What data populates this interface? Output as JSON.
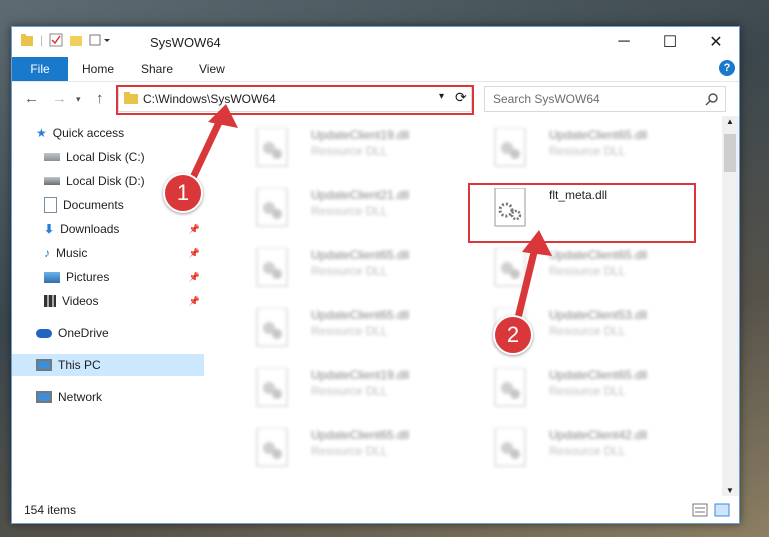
{
  "window": {
    "title": "SysWOW64",
    "minimize": "─",
    "maximize": "☐",
    "close": "✕"
  },
  "ribbon": {
    "tabs": [
      "File",
      "Home",
      "Share",
      "View"
    ],
    "help": "?"
  },
  "nav": {
    "address": "C:\\Windows\\SysWOW64",
    "search_placeholder": "Search SysWOW64"
  },
  "sidebar": {
    "items": [
      {
        "label": "Quick access",
        "icon": "star-icon"
      },
      {
        "label": "Local Disk (C:)",
        "icon": "drive-icon"
      },
      {
        "label": "Local Disk (D:)",
        "icon": "drive-icon"
      },
      {
        "label": "Documents",
        "icon": "documents-icon"
      },
      {
        "label": "Downloads",
        "icon": "download-icon"
      },
      {
        "label": "Music",
        "icon": "music-icon"
      },
      {
        "label": "Pictures",
        "icon": "pictures-icon"
      },
      {
        "label": "Videos",
        "icon": "videos-icon"
      },
      {
        "label": "OneDrive",
        "icon": "cloud-icon"
      },
      {
        "label": "This PC",
        "icon": "computer-icon",
        "selected": true
      },
      {
        "label": "Network",
        "icon": "network-icon"
      }
    ]
  },
  "files": [
    {
      "name": "UpdateClient19.dll",
      "type": "Resource DLL",
      "blurred": true
    },
    {
      "name": "UpdateClient65.dll",
      "type": "Resource DLL",
      "blurred": true
    },
    {
      "name": "UpdateClient21.dll",
      "type": "Resource DLL",
      "blurred": true
    },
    {
      "name": "flt_meta.dll",
      "type": "",
      "blurred": false
    },
    {
      "name": "UpdateClient65.dll",
      "type": "Resource DLL",
      "blurred": true
    },
    {
      "name": "UpdateClient65.dll",
      "type": "Resource DLL",
      "blurred": true
    },
    {
      "name": "UpdateClient65.dll",
      "type": "Resource DLL",
      "blurred": true
    },
    {
      "name": "UpdateClient53.dll",
      "type": "Resource DLL",
      "blurred": true
    },
    {
      "name": "UpdateClient19.dll",
      "type": "Resource DLL",
      "blurred": true
    },
    {
      "name": "UpdateClient65.dll",
      "type": "Resource DLL",
      "blurred": true
    },
    {
      "name": "UpdateClient65.dll",
      "type": "Resource DLL",
      "blurred": true
    },
    {
      "name": "UpdateClient42.dll",
      "type": "Resource DLL",
      "blurred": true
    }
  ],
  "status": {
    "count": "154 items"
  },
  "annotations": {
    "marker1": "1",
    "marker2": "2",
    "color": "#d9373a"
  }
}
